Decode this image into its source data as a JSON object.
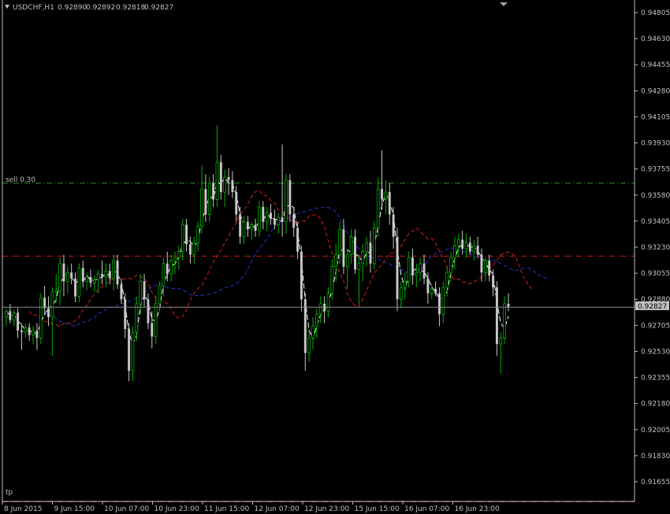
{
  "header": {
    "symbol": "USDCHF,H1",
    "open": "0.92890",
    "high": "0.92892",
    "low": "0.92818",
    "close": "0.92827"
  },
  "colors": {
    "background": "#000000",
    "axis": "#c0c0c0",
    "text": "#c0c0c0",
    "bull": "#00b000",
    "bear": "#c8c8c8",
    "ma_fast": "#ffffff",
    "ma_mid": "#d22020",
    "ma_slow": "#2433c8",
    "sell_line": "#2e8b2e",
    "level_line": "#c81e1e",
    "tp_line": "#c81e1e",
    "price_line": "#8c8c8c",
    "price_label_bg": "#c0c0c0",
    "price_label_text": "#000000"
  },
  "levels": {
    "sell_label": "sell 0.30",
    "sell_price": 0.9366,
    "level_price": 0.9317,
    "tp_label": "tp",
    "tp_price": 0.9152
  },
  "chart_data": {
    "type": "candlestick",
    "symbol": "USDCHF",
    "timeframe": "H1",
    "last_price": "0.92827",
    "y_ticks": [
      "0.94805",
      "0.94630",
      "0.94455",
      "0.94280",
      "0.94105",
      "0.93930",
      "0.93755",
      "0.93580",
      "0.93405",
      "0.93230",
      "0.93055",
      "0.92880",
      "0.92705",
      "0.92530",
      "0.92355",
      "0.92180",
      "0.92005",
      "0.91830",
      "0.91655"
    ],
    "x_ticks": [
      "8 Jun 2015",
      "9 Jun 15:00",
      "10 Jun 07:00",
      "10 Jun 23:00",
      "11 Jun 15:00",
      "12 Jun 07:00",
      "12 Jun 23:00",
      "15 Jun 15:00",
      "16 Jun 07:00",
      "16 Jun 23:00"
    ],
    "ylim": [
      0.915,
      0.949
    ],
    "moving_averages": [
      "fast",
      "mid",
      "slow"
    ],
    "candles": [
      [
        0.9276,
        0.9282,
        0.927,
        0.928
      ],
      [
        0.928,
        0.9285,
        0.9272,
        0.9274
      ],
      [
        0.9274,
        0.9281,
        0.927,
        0.9279
      ],
      [
        0.9279,
        0.9282,
        0.9262,
        0.9267
      ],
      [
        0.9267,
        0.9272,
        0.9254,
        0.9266
      ],
      [
        0.9266,
        0.9272,
        0.9262,
        0.9269
      ],
      [
        0.9269,
        0.9272,
        0.926,
        0.9264
      ],
      [
        0.9264,
        0.927,
        0.9258,
        0.9267
      ],
      [
        0.9267,
        0.9272,
        0.9254,
        0.9262
      ],
      [
        0.9262,
        0.9292,
        0.9258,
        0.9289
      ],
      [
        0.9289,
        0.9297,
        0.9278,
        0.9282
      ],
      [
        0.9282,
        0.929,
        0.927,
        0.9276
      ],
      [
        0.9276,
        0.9296,
        0.925,
        0.9293
      ],
      [
        0.9293,
        0.9305,
        0.9286,
        0.9294
      ],
      [
        0.9294,
        0.9316,
        0.9284,
        0.9312
      ],
      [
        0.9312,
        0.9318,
        0.929,
        0.93
      ],
      [
        0.93,
        0.931,
        0.9292,
        0.9306
      ],
      [
        0.9306,
        0.9312,
        0.9298,
        0.9302
      ],
      [
        0.9302,
        0.9306,
        0.9286,
        0.929
      ],
      [
        0.929,
        0.9312,
        0.9286,
        0.9309
      ],
      [
        0.9309,
        0.9314,
        0.9296,
        0.93
      ],
      [
        0.93,
        0.9306,
        0.9294,
        0.9303
      ],
      [
        0.9303,
        0.9308,
        0.9296,
        0.9299
      ],
      [
        0.9299,
        0.9304,
        0.9293,
        0.9301
      ],
      [
        0.9301,
        0.9308,
        0.9292,
        0.9305
      ],
      [
        0.9305,
        0.9314,
        0.9298,
        0.9303
      ],
      [
        0.9303,
        0.9312,
        0.9296,
        0.9307
      ],
      [
        0.9307,
        0.9312,
        0.9298,
        0.9302
      ],
      [
        0.9302,
        0.9318,
        0.9294,
        0.9314
      ],
      [
        0.9314,
        0.9318,
        0.9295,
        0.9298
      ],
      [
        0.9298,
        0.9302,
        0.9285,
        0.9288
      ],
      [
        0.9288,
        0.9292,
        0.9262,
        0.9268
      ],
      [
        0.9268,
        0.9272,
        0.9233,
        0.924
      ],
      [
        0.924,
        0.927,
        0.9233,
        0.9266
      ],
      [
        0.9266,
        0.929,
        0.926,
        0.9285
      ],
      [
        0.9285,
        0.9305,
        0.9278,
        0.93
      ],
      [
        0.93,
        0.9305,
        0.9283,
        0.9288
      ],
      [
        0.9288,
        0.9292,
        0.9268,
        0.9272
      ],
      [
        0.9272,
        0.928,
        0.9255,
        0.9263
      ],
      [
        0.9263,
        0.929,
        0.9258,
        0.9285
      ],
      [
        0.9285,
        0.93,
        0.928,
        0.9297
      ],
      [
        0.9297,
        0.9316,
        0.929,
        0.9312
      ],
      [
        0.9312,
        0.932,
        0.93,
        0.9305
      ],
      [
        0.9305,
        0.9318,
        0.93,
        0.9314
      ],
      [
        0.9314,
        0.932,
        0.9305,
        0.9316
      ],
      [
        0.9316,
        0.9324,
        0.9308,
        0.932
      ],
      [
        0.932,
        0.9342,
        0.9314,
        0.9338
      ],
      [
        0.9338,
        0.9342,
        0.932,
        0.9325
      ],
      [
        0.9325,
        0.933,
        0.9312,
        0.9318
      ],
      [
        0.9318,
        0.933,
        0.9312,
        0.9326
      ],
      [
        0.9326,
        0.934,
        0.932,
        0.9337
      ],
      [
        0.9337,
        0.9378,
        0.9332,
        0.9362
      ],
      [
        0.9362,
        0.9372,
        0.934,
        0.9345
      ],
      [
        0.9345,
        0.937,
        0.934,
        0.9366
      ],
      [
        0.9366,
        0.9372,
        0.935,
        0.9355
      ],
      [
        0.9355,
        0.9405,
        0.935,
        0.938
      ],
      [
        0.938,
        0.9385,
        0.9355,
        0.936
      ],
      [
        0.936,
        0.9375,
        0.935,
        0.937
      ],
      [
        0.937,
        0.9376,
        0.9358,
        0.9368
      ],
      [
        0.9368,
        0.9374,
        0.9356,
        0.936
      ],
      [
        0.936,
        0.9364,
        0.934,
        0.9345
      ],
      [
        0.9345,
        0.935,
        0.9325,
        0.933
      ],
      [
        0.933,
        0.9344,
        0.9325,
        0.934
      ],
      [
        0.934,
        0.9344,
        0.933,
        0.9335
      ],
      [
        0.9335,
        0.934,
        0.9328,
        0.9338
      ],
      [
        0.9338,
        0.9342,
        0.933,
        0.9334
      ],
      [
        0.9334,
        0.9354,
        0.933,
        0.935
      ],
      [
        0.935,
        0.9354,
        0.9335,
        0.934
      ],
      [
        0.934,
        0.935,
        0.9334,
        0.9346
      ],
      [
        0.9346,
        0.9352,
        0.9338,
        0.9342
      ],
      [
        0.9342,
        0.9348,
        0.9335,
        0.9338
      ],
      [
        0.9338,
        0.9346,
        0.9332,
        0.9343
      ],
      [
        0.9343,
        0.9392,
        0.933,
        0.934
      ],
      [
        0.934,
        0.9372,
        0.9332,
        0.9368
      ],
      [
        0.9368,
        0.9372,
        0.934,
        0.9345
      ],
      [
        0.9345,
        0.935,
        0.933,
        0.9336
      ],
      [
        0.9336,
        0.934,
        0.9315,
        0.932
      ],
      [
        0.932,
        0.9324,
        0.928,
        0.9288
      ],
      [
        0.9288,
        0.9292,
        0.924,
        0.9252
      ],
      [
        0.9252,
        0.9268,
        0.9246,
        0.9262
      ],
      [
        0.9262,
        0.9276,
        0.9254,
        0.927
      ],
      [
        0.927,
        0.9282,
        0.9262,
        0.9278
      ],
      [
        0.9278,
        0.929,
        0.9272,
        0.9285
      ],
      [
        0.9285,
        0.929,
        0.9272,
        0.928
      ],
      [
        0.928,
        0.9296,
        0.9276,
        0.9292
      ],
      [
        0.9292,
        0.9315,
        0.9288,
        0.931
      ],
      [
        0.931,
        0.9325,
        0.93,
        0.9318
      ],
      [
        0.9318,
        0.934,
        0.9312,
        0.9335
      ],
      [
        0.9335,
        0.9342,
        0.9305,
        0.931
      ],
      [
        0.931,
        0.9322,
        0.9295,
        0.9318
      ],
      [
        0.9318,
        0.9335,
        0.9312,
        0.933
      ],
      [
        0.933,
        0.9335,
        0.9305,
        0.9308
      ],
      [
        0.9308,
        0.9318,
        0.9285,
        0.9312
      ],
      [
        0.9312,
        0.9325,
        0.93,
        0.932
      ],
      [
        0.932,
        0.933,
        0.931,
        0.9326
      ],
      [
        0.9326,
        0.9334,
        0.9306,
        0.9312
      ],
      [
        0.9312,
        0.934,
        0.9308,
        0.9336
      ],
      [
        0.9336,
        0.937,
        0.933,
        0.9362
      ],
      [
        0.9362,
        0.9388,
        0.9348,
        0.9355
      ],
      [
        0.9355,
        0.9368,
        0.9345,
        0.936
      ],
      [
        0.936,
        0.9366,
        0.9338,
        0.9345
      ],
      [
        0.9345,
        0.935,
        0.9322,
        0.933
      ],
      [
        0.933,
        0.9336,
        0.928,
        0.9288
      ],
      [
        0.9288,
        0.93,
        0.9282,
        0.9296
      ],
      [
        0.9296,
        0.9306,
        0.9288,
        0.93
      ],
      [
        0.93,
        0.932,
        0.9296,
        0.9316
      ],
      [
        0.9316,
        0.9322,
        0.9298,
        0.9304
      ],
      [
        0.9304,
        0.9312,
        0.9296,
        0.9306
      ],
      [
        0.9306,
        0.9316,
        0.93,
        0.9312
      ],
      [
        0.9312,
        0.9318,
        0.9298,
        0.9302
      ],
      [
        0.9302,
        0.9306,
        0.9285,
        0.9292
      ],
      [
        0.9292,
        0.9298,
        0.9288,
        0.9295
      ],
      [
        0.9295,
        0.93,
        0.929,
        0.9292
      ],
      [
        0.9292,
        0.9296,
        0.927,
        0.9278
      ],
      [
        0.9278,
        0.93,
        0.9272,
        0.9296
      ],
      [
        0.9296,
        0.931,
        0.929,
        0.9306
      ],
      [
        0.9306,
        0.932,
        0.93,
        0.9316
      ],
      [
        0.9316,
        0.933,
        0.9308,
        0.9324
      ],
      [
        0.9324,
        0.9332,
        0.9316,
        0.9328
      ],
      [
        0.9328,
        0.9334,
        0.9318,
        0.9322
      ],
      [
        0.9322,
        0.9332,
        0.9316,
        0.9326
      ],
      [
        0.9326,
        0.933,
        0.9318,
        0.932
      ],
      [
        0.932,
        0.9328,
        0.9314,
        0.9324
      ],
      [
        0.9324,
        0.933,
        0.9316,
        0.9318
      ],
      [
        0.9318,
        0.9322,
        0.93,
        0.9306
      ],
      [
        0.9306,
        0.9316,
        0.93,
        0.9314
      ],
      [
        0.9314,
        0.9318,
        0.93,
        0.9304
      ],
      [
        0.9304,
        0.9308,
        0.929,
        0.9296
      ],
      [
        0.9296,
        0.93,
        0.925,
        0.9258
      ],
      [
        0.9258,
        0.9266,
        0.9238,
        0.9262
      ],
      [
        0.9262,
        0.929,
        0.9258,
        0.9285
      ],
      [
        0.9285,
        0.9292,
        0.928,
        0.9283
      ]
    ]
  }
}
